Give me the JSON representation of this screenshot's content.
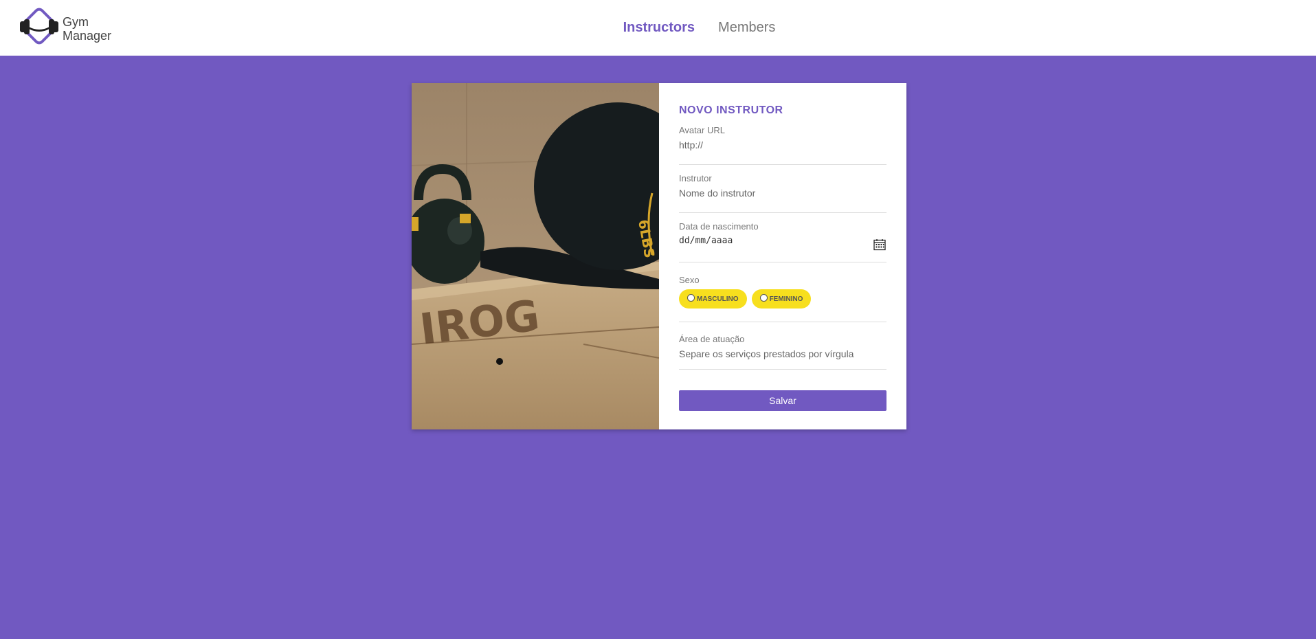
{
  "app": {
    "logo_line1": "Gym",
    "logo_line2": "Manager"
  },
  "nav": {
    "instructors": "Instructors",
    "members": "Members"
  },
  "form": {
    "title": "NOVO INSTRUTOR",
    "avatar_label": "Avatar URL",
    "avatar_placeholder": "http://",
    "name_label": "Instrutor",
    "name_placeholder": "Nome do instrutor",
    "birth_label": "Data de nascimento",
    "birth_placeholder": "dd/mm/aaaa",
    "gender_label": "Sexo",
    "gender_options": [
      "MASCULINO",
      "FEMININO"
    ],
    "area_label": "Área de atuação",
    "area_placeholder": "Separe os serviços prestados por vírgula",
    "save_label": "Salvar"
  },
  "colors": {
    "accent": "#7159c1",
    "pill": "#f7df1e"
  },
  "icons": {
    "logo": "dumbbell-icon",
    "date": "calendar-icon"
  }
}
